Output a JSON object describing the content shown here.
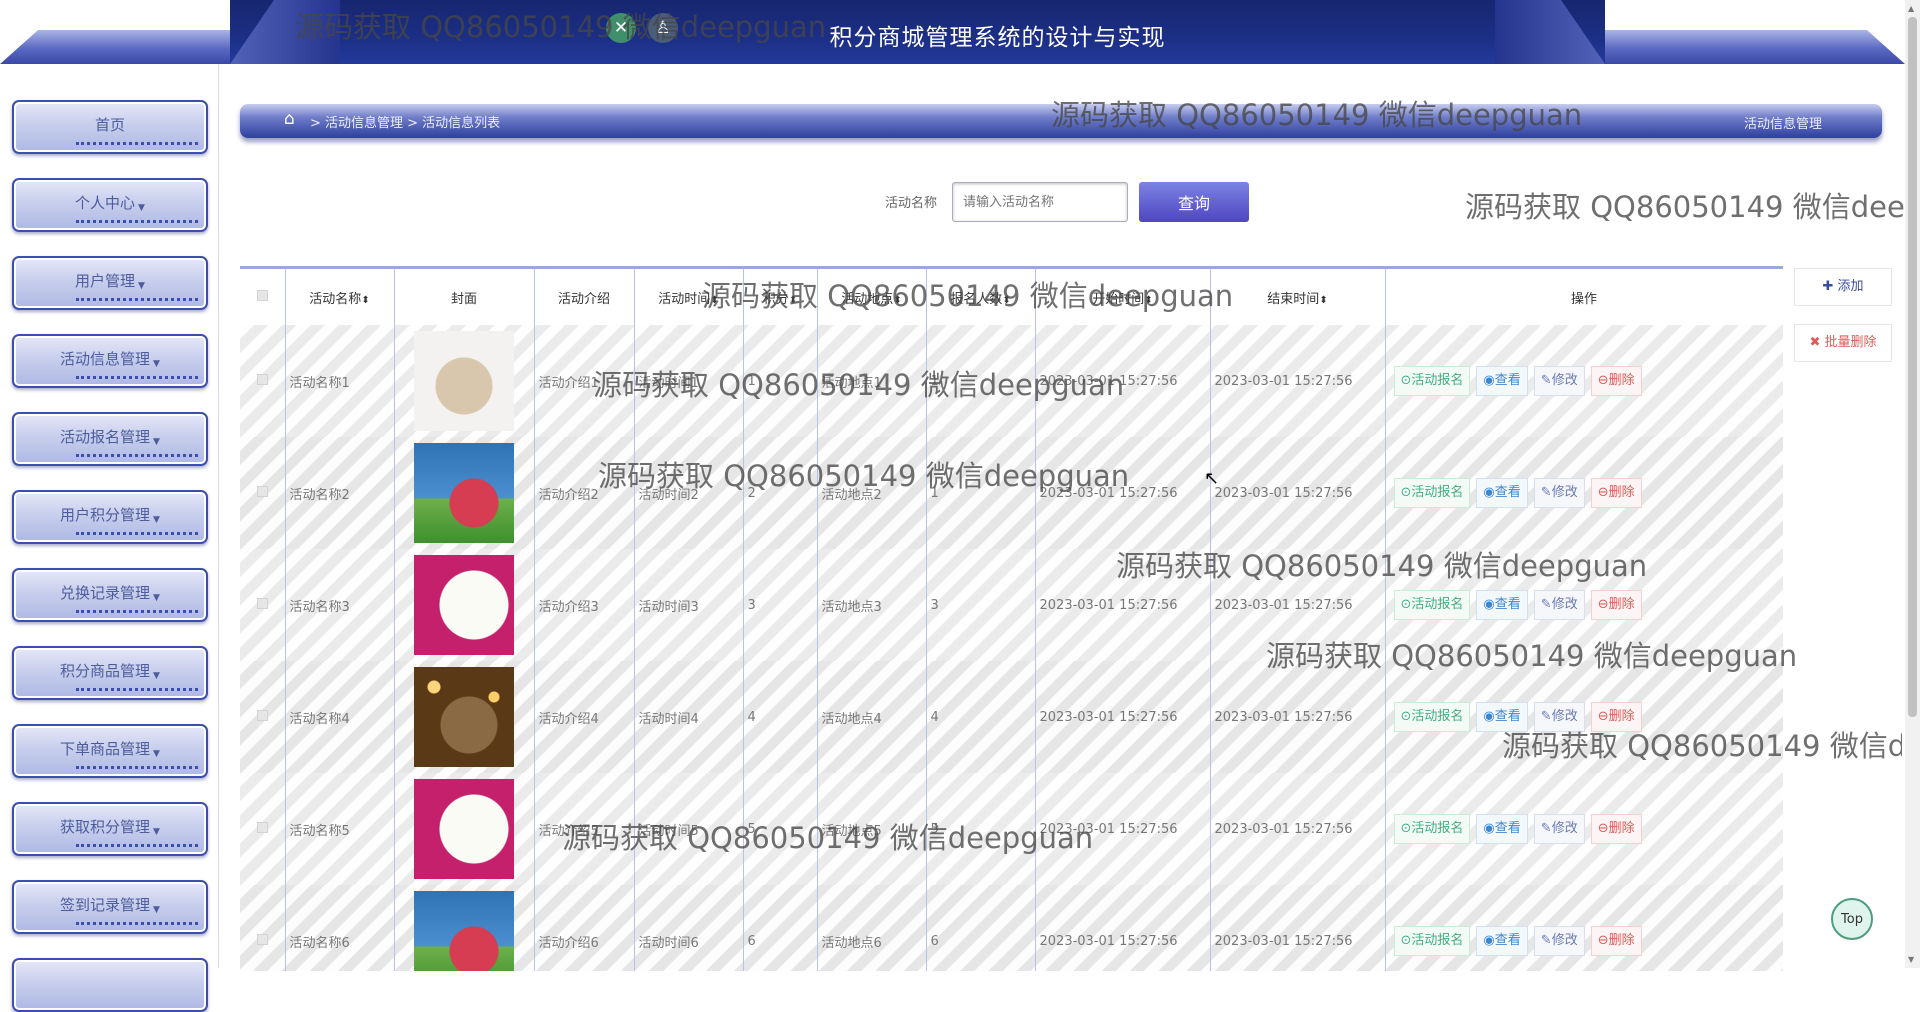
{
  "header": {
    "title": "积分商城管理系统的设计与实现",
    "back_icon": "x-icon",
    "user_icon": "user-icon"
  },
  "sidebar": {
    "items": [
      {
        "label": "首页",
        "has_caret": false
      },
      {
        "label": "个人中心",
        "has_caret": true
      },
      {
        "label": "用户管理",
        "has_caret": true
      },
      {
        "label": "活动信息管理",
        "has_caret": true
      },
      {
        "label": "活动报名管理",
        "has_caret": true
      },
      {
        "label": "用户积分管理",
        "has_caret": true
      },
      {
        "label": "兑换记录管理",
        "has_caret": true
      },
      {
        "label": "积分商品管理",
        "has_caret": true
      },
      {
        "label": "下单商品管理",
        "has_caret": true
      },
      {
        "label": "获取积分管理",
        "has_caret": true
      },
      {
        "label": "签到记录管理",
        "has_caret": true
      }
    ]
  },
  "breadcrumb": {
    "path": "> 活动信息管理 > 活动信息列表",
    "right": "活动信息管理"
  },
  "search": {
    "label": "活动名称",
    "placeholder": "请输入活动名称",
    "button": "查询"
  },
  "actions": {
    "add": "添加",
    "batch_delete": "批量删除",
    "top": "Top"
  },
  "table": {
    "columns": [
      "活动名称",
      "封面",
      "活动介绍",
      "活动时间",
      "积分",
      "活动地点",
      "报名人数",
      "开始时间",
      "结束时间",
      "操作"
    ],
    "row_actions": {
      "join": "活动报名",
      "view": "查看",
      "edit": "修改",
      "delete": "删除"
    },
    "rows": [
      {
        "name": "活动名称1",
        "cover": "cat",
        "intro": "活动介绍1",
        "time": "活动时间1",
        "points": "1",
        "place": "活动地点1",
        "count": "1",
        "start": "2023-03-01 15:27:56",
        "end": "2023-03-01 15:27:56"
      },
      {
        "name": "活动名称2",
        "cover": "dog-girl",
        "intro": "活动介绍2",
        "time": "活动时间2",
        "points": "2",
        "place": "活动地点2",
        "count": "1",
        "start": "2023-03-01 15:27:56",
        "end": "2023-03-01 15:27:56"
      },
      {
        "name": "活动名称3",
        "cover": "poodle",
        "intro": "活动介绍3",
        "time": "活动时间3",
        "points": "3",
        "place": "活动地点3",
        "count": "3",
        "start": "2023-03-01 15:27:56",
        "end": "2023-03-01 15:27:56"
      },
      {
        "name": "活动名称4",
        "cover": "tabby",
        "intro": "活动介绍4",
        "time": "活动时间4",
        "points": "4",
        "place": "活动地点4",
        "count": "4",
        "start": "2023-03-01 15:27:56",
        "end": "2023-03-01 15:27:56"
      },
      {
        "name": "活动名称5",
        "cover": "poodle",
        "intro": "活动介绍5",
        "time": "活动时间5",
        "points": "5",
        "place": "活动地点5",
        "count": "5",
        "start": "2023-03-01 15:27:56",
        "end": "2023-03-01 15:27:56"
      },
      {
        "name": "活动名称6",
        "cover": "dog-girl",
        "intro": "活动介绍6",
        "time": "活动时间6",
        "points": "6",
        "place": "活动地点6",
        "count": "6",
        "start": "2023-03-01 15:27:56",
        "end": "2023-03-01 15:27:56"
      }
    ]
  },
  "watermark": "源码获取 QQ86050149 微信deepguan"
}
